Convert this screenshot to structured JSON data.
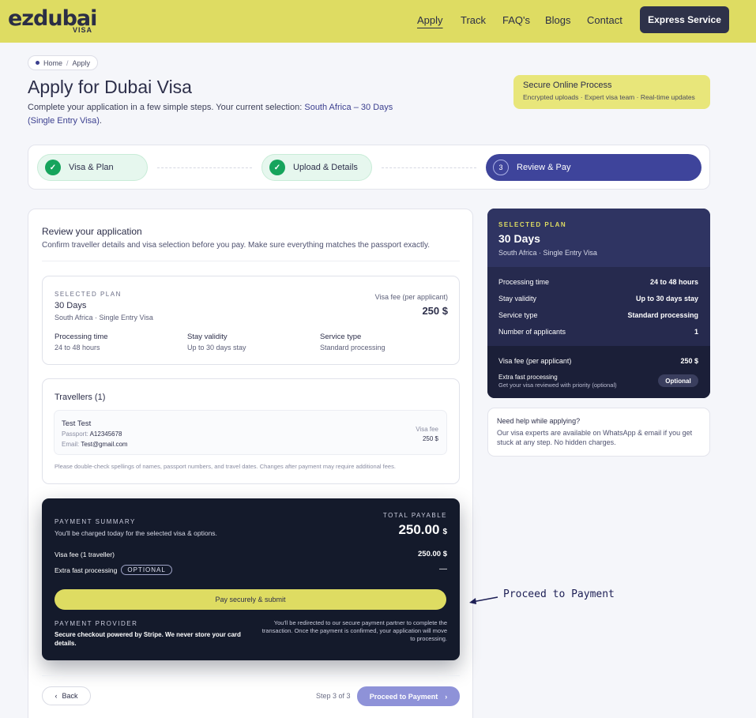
{
  "header": {
    "logo_main": "ezdubai",
    "logo_sub": "VISA",
    "nav": [
      "Apply",
      "Track",
      "FAQ's",
      "Blogs",
      "Contact"
    ],
    "express_label": "Express Service"
  },
  "breadcrumb": {
    "home": "Home",
    "separator": "/",
    "current": "Apply"
  },
  "page": {
    "title": "Apply for Dubai Visa",
    "subtitle_prefix": "Complete your application in a few simple steps. Your current selection: ",
    "subtitle_highlight": "South Africa – 30 Days (Single Entry Visa)",
    "subtitle_suffix": "."
  },
  "secure": {
    "title": "Secure Online Process",
    "subtitle": "Encrypted uploads · Expert visa team · Real-time updates"
  },
  "stepper": {
    "steps": [
      {
        "label": "Visa & Plan",
        "state": "done",
        "marker": "✓"
      },
      {
        "label": "Upload & Details",
        "state": "done",
        "marker": "✓"
      },
      {
        "label": "Review & Pay",
        "state": "current",
        "marker": "3"
      }
    ]
  },
  "review": {
    "title": "Review your application",
    "subtitle": "Confirm traveller details and visa selection before you pay. Make sure everything matches the passport exactly."
  },
  "plan": {
    "caption": "SELECTED PLAN",
    "name": "30 Days",
    "detail": "South Africa · Single Entry Visa",
    "fee_label": "Visa fee (per applicant)",
    "fee_value": "250 $",
    "processing_label": "Processing time",
    "processing_value": "24 to 48 hours",
    "validity_label": "Stay validity",
    "validity_value": "Up to 30 days stay",
    "service_label": "Service type",
    "service_value": "Standard processing"
  },
  "travellers": {
    "title": "Travellers (1)",
    "name": "Test Test",
    "passport_label": "Passport:",
    "passport_value": "A12345678",
    "email_label": "Email:",
    "email_value": "Test@gmail.com",
    "fee_label": "Visa fee",
    "fee_value": "250 $",
    "note": "Please double-check spellings of names, passport numbers, and travel dates. Changes after payment may require additional fees."
  },
  "payment": {
    "caption": "PAYMENT SUMMARY",
    "subtitle": "You'll be charged today for the selected visa & options.",
    "total_caption": "TOTAL PAYABLE",
    "total_value": "250.00",
    "total_currency": "$",
    "fee_label": "Visa fee (1 traveller)",
    "fee_value": "250.00 $",
    "extra_label": "Extra fast processing",
    "extra_badge": "OPTIONAL",
    "extra_value": "—",
    "pay_button": "Pay securely & submit",
    "provider_caption": "PAYMENT PROVIDER",
    "provider_text": "Secure checkout powered by Stripe. We never store your card details.",
    "redirect_text": "You'll be redirected to our secure payment partner to complete the transaction. Once the payment is confirmed, your application will move to processing."
  },
  "footer_nav": {
    "back_icon": "‹",
    "back_label": "Back",
    "step_text": "Step 3 of 3",
    "proceed_label": "Proceed to Payment",
    "proceed_icon": "›"
  },
  "side": {
    "caption": "SELECTED PLAN",
    "name": "30 Days",
    "detail": "South Africa · Single Entry Visa",
    "rows": [
      {
        "label": "Processing time",
        "value": "24 to 48 hours"
      },
      {
        "label": "Stay validity",
        "value": "Up to 30 days stay"
      },
      {
        "label": "Service type",
        "value": "Standard processing"
      },
      {
        "label": "Number of applicants",
        "value": "1"
      }
    ],
    "fee_label": "Visa fee (per applicant)",
    "fee_value": "250 $",
    "extra_label": "Extra fast processing",
    "extra_sub": "Get your visa reviewed with priority (optional)",
    "extra_pill": "Optional"
  },
  "help": {
    "title": "Need help while applying?",
    "text": "Our visa experts are available on WhatsApp & email if you get stuck at any step. No hidden charges."
  },
  "annotation": {
    "text": "Proceed to Payment"
  },
  "colors": {
    "brand_yellow": "#dedc62",
    "navy": "#2e3249",
    "accent_indigo": "#3e449b",
    "success_green": "#16a45c",
    "dark_panel": "#141a2b"
  }
}
